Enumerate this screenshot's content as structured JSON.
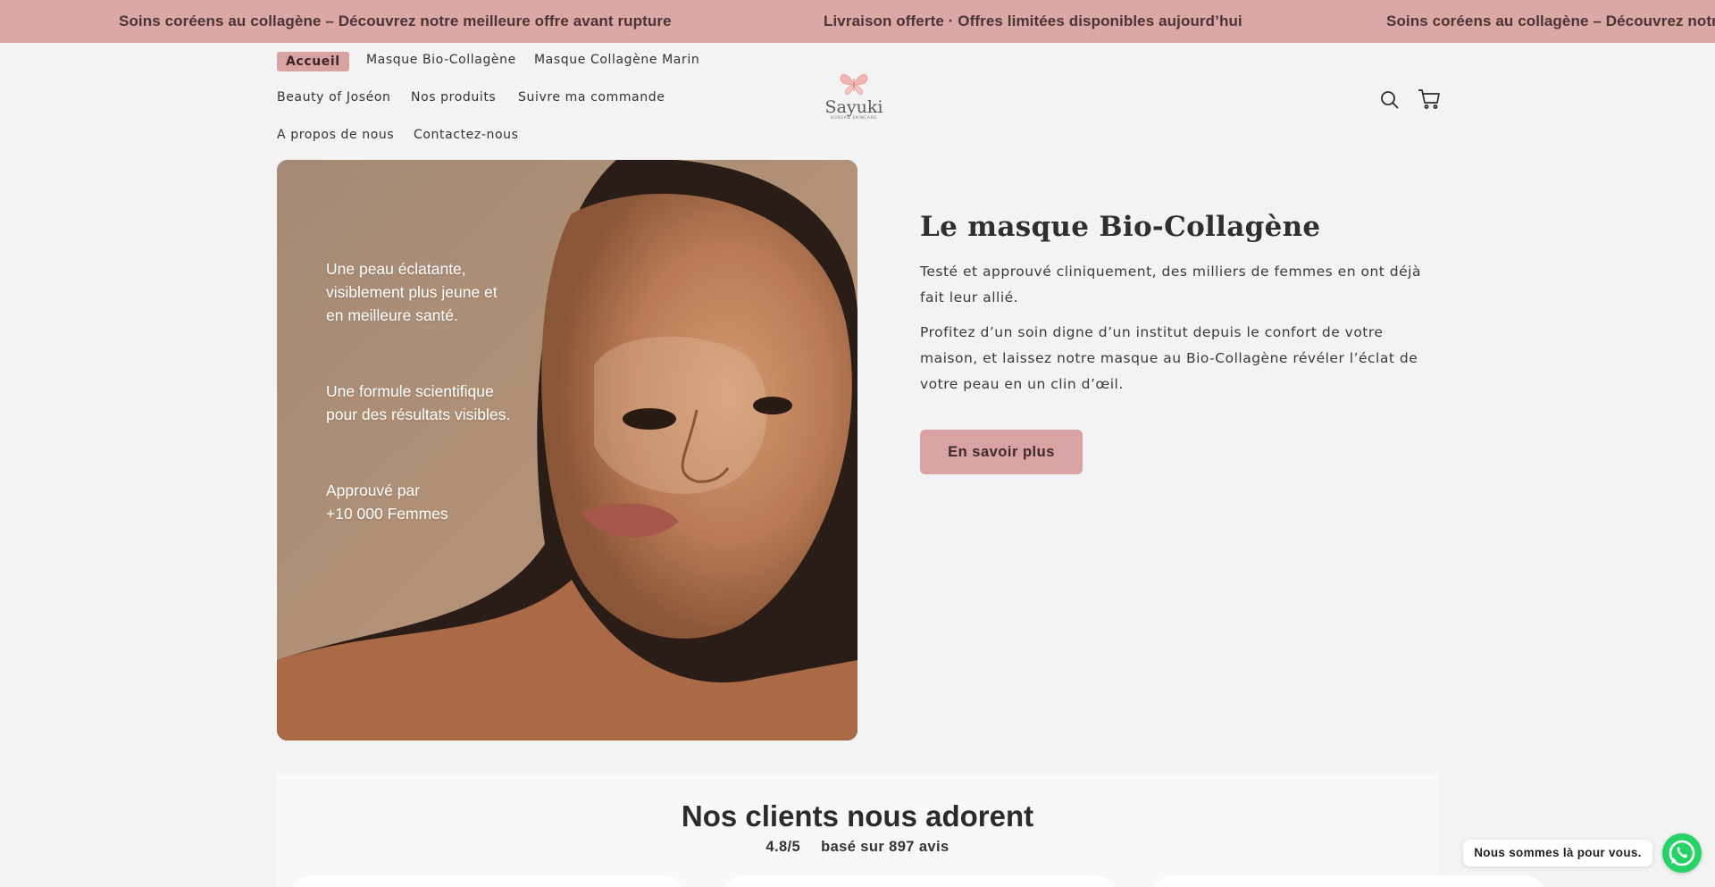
{
  "announcement": {
    "messages": [
      "Soins coréens au collagène – Découvrez notre meilleure offre avant rupture",
      "Livraison offerte · Offres limitées disponibles aujourd’hui",
      "Soins coréens au collagène – Découvrez notre meilleure offre avant rupture"
    ]
  },
  "header": {
    "nav": [
      "Accueil",
      "Masque Bio-Collagène",
      "Masque Collagène Marin",
      "Beauty of Joséon",
      "Nos produits",
      "Suivre ma commande",
      "A propos de nous",
      "Contactez-nous"
    ],
    "active_nav": "Accueil",
    "logo": {
      "name": "Sayuki",
      "tagline": "KOREAN SKINCARE"
    },
    "icons": [
      "search-icon",
      "cart-icon"
    ]
  },
  "hero": {
    "image_callouts": [
      "Une peau éclatante,\nvisiblement plus jeune et\nen meilleure santé.",
      "Une formule scientifique\npour des résultats visibles.",
      "Approuvé par\n+10 000 Femmes"
    ],
    "title": "Le masque Bio-Collagène",
    "paragraphs": [
      "Testé et approuvé cliniquement, des milliers de femmes en ont déjà fait leur allié.",
      "Profitez d’un soin digne d’un institut depuis le confort de votre maison, et laissez notre masque au Bio-Collagène révéler l’éclat de votre peau en un clin d’œil."
    ],
    "cta_label": "En savoir plus"
  },
  "reviews": {
    "title": "Nos clients nous adorent",
    "score": "4.8/5",
    "count_text": "basé sur 897 avis"
  },
  "chat": {
    "bubble_text": "Nous sommes là pour vous.",
    "icon": "whatsapp-icon"
  },
  "colors": {
    "accent": "#d9a3a3",
    "announcement_bg": "#dba8a6",
    "page_bg": "#f3f3f3",
    "whatsapp": "#25d366"
  }
}
